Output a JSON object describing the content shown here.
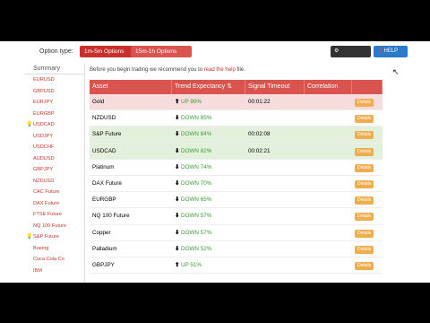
{
  "header": {
    "option_type_label": "Option type:",
    "option_a": "1m-5m Options",
    "option_b": "15m-1h Options",
    "settings": "SETTINGS",
    "help": "HELP"
  },
  "sidebar": {
    "title": "Summary",
    "items": [
      {
        "label": "EURUSD",
        "bulb": false
      },
      {
        "label": "GBPUSD",
        "bulb": false
      },
      {
        "label": "EURJPY",
        "bulb": false
      },
      {
        "label": "EURGBP",
        "bulb": false
      },
      {
        "label": "USDCAD",
        "bulb": true
      },
      {
        "label": "USDJPY",
        "bulb": false
      },
      {
        "label": "USDCHF",
        "bulb": false
      },
      {
        "label": "AUDUSD",
        "bulb": false
      },
      {
        "label": "GBPJPY",
        "bulb": false
      },
      {
        "label": "NZDUSD",
        "bulb": false
      },
      {
        "label": "CAC Future",
        "bulb": false
      },
      {
        "label": "DAX Future",
        "bulb": false
      },
      {
        "label": "FTSE Future",
        "bulb": false
      },
      {
        "label": "NQ 100 Future",
        "bulb": false
      },
      {
        "label": "S&P Future",
        "bulb": true
      },
      {
        "label": "Boeing",
        "bulb": false
      },
      {
        "label": "Coca Cola Co",
        "bulb": false
      },
      {
        "label": "IBM",
        "bulb": false
      }
    ]
  },
  "intro": {
    "before": "Before you begin trading we recommend you to ",
    "link": "read the help",
    "after": " file."
  },
  "table": {
    "headers": [
      "Asset",
      "Trend Expectancy",
      "Signal Timeout",
      "Correlation",
      ""
    ],
    "rows": [
      {
        "asset": "Gold",
        "dir": "UP",
        "pct": "90%",
        "timeout": "00:01:22",
        "style": "pink"
      },
      {
        "asset": "NZDUSD",
        "dir": "DOWN",
        "pct": "85%",
        "timeout": "",
        "style": ""
      },
      {
        "asset": "S&P Future",
        "dir": "DOWN",
        "pct": "84%",
        "timeout": "00:02:08",
        "style": "green"
      },
      {
        "asset": "USDCAD",
        "dir": "DOWN",
        "pct": "82%",
        "timeout": "00:02:21",
        "style": "green"
      },
      {
        "asset": "Platinum",
        "dir": "DOWN",
        "pct": "74%",
        "timeout": "",
        "style": ""
      },
      {
        "asset": "DAX Future",
        "dir": "DOWN",
        "pct": "70%",
        "timeout": "",
        "style": ""
      },
      {
        "asset": "EURGBP",
        "dir": "DOWN",
        "pct": "65%",
        "timeout": "",
        "style": ""
      },
      {
        "asset": "NQ 100 Future",
        "dir": "DOWN",
        "pct": "57%",
        "timeout": "",
        "style": ""
      },
      {
        "asset": "Copper",
        "dir": "DOWN",
        "pct": "57%",
        "timeout": "",
        "style": ""
      },
      {
        "asset": "Palladium",
        "dir": "DOWN",
        "pct": "52%",
        "timeout": "",
        "style": ""
      },
      {
        "asset": "GBPJPY",
        "dir": "UP",
        "pct": "51%",
        "timeout": "",
        "style": ""
      }
    ],
    "detail_label": "Details"
  }
}
